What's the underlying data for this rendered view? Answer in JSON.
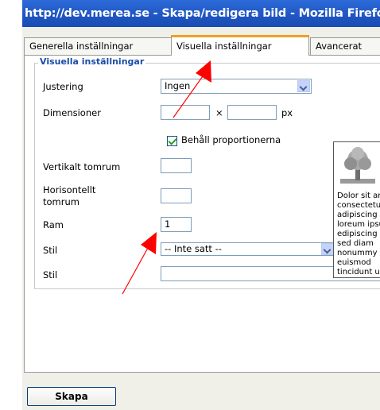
{
  "window": {
    "title": "http://dev.merea.se - Skapa/redigera bild - Mozilla Firefox"
  },
  "tabs": [
    {
      "label": "Generella inställningar",
      "active": false
    },
    {
      "label": "Visuella inställningar",
      "active": true
    },
    {
      "label": "Avancerat",
      "active": false
    }
  ],
  "form": {
    "legend": "Visuella inställningar",
    "alignment": {
      "label": "Justering",
      "value": "Ingen"
    },
    "dimensions": {
      "label": "Dimensioner",
      "width": "",
      "height": "",
      "separator": "×",
      "unit": "px"
    },
    "keep_proportions": {
      "label": "Behåll proportionerna",
      "checked": true
    },
    "vspace": {
      "label": "Vertikalt tomrum",
      "value": ""
    },
    "hspace": {
      "label_line1": "Horisontellt",
      "label_line2": "tomrum",
      "value": ""
    },
    "border": {
      "label": "Ram",
      "value": "1"
    },
    "class": {
      "label": "Stil",
      "value": "-- Inte satt --"
    },
    "style": {
      "label": "Stil",
      "value": ""
    }
  },
  "preview": {
    "text": "Dolor sit amet, consectetuer adipiscing loreum ipsum edipiscing elit, sed diam nonummy nibh euismod tincidunt ut laoreet dolore magna aliquam erat volutpat."
  },
  "buttons": {
    "create": "Skapa"
  },
  "colors": {
    "title_bar": "#1f55c2",
    "tab_highlight": "#f0a020",
    "legend": "#1a4ca8",
    "annotation_arrow": "#ff0000"
  }
}
